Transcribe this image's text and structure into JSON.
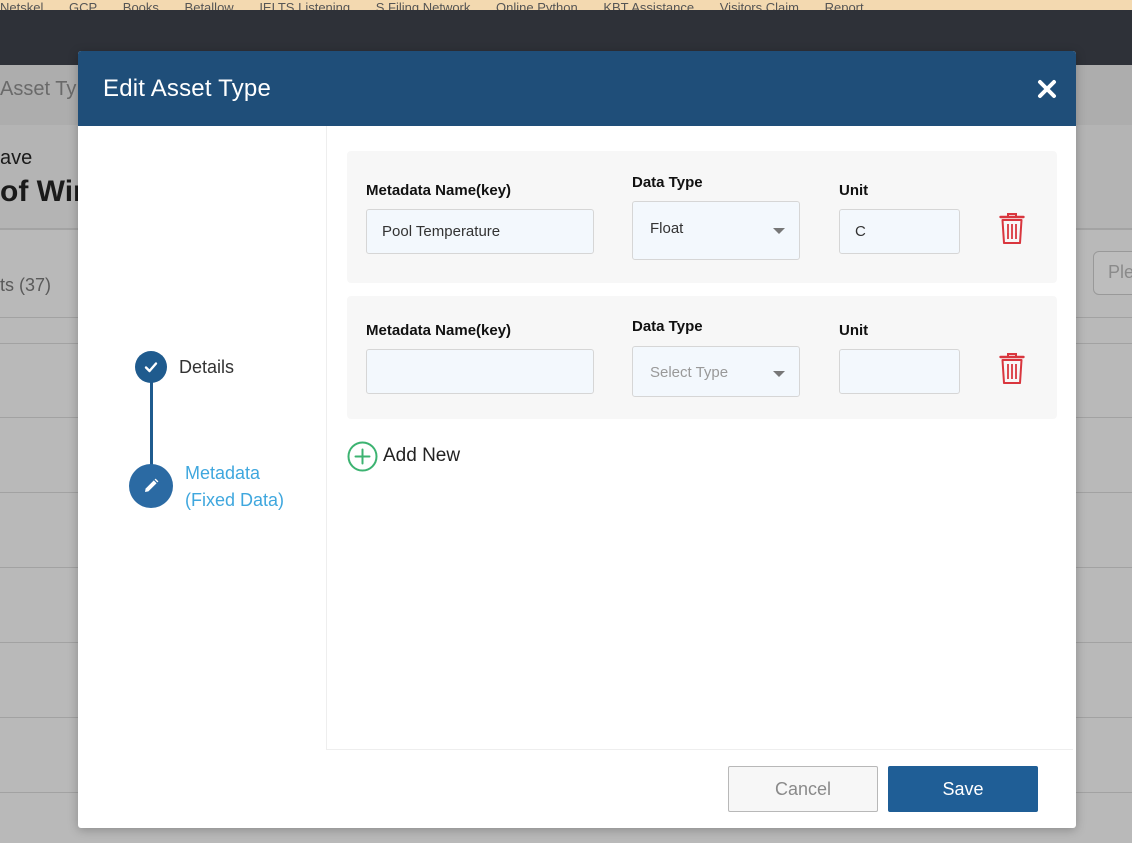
{
  "browser": {
    "bookmarks": [
      "Netskel",
      "GCP",
      "Books",
      "Betallow",
      "IELTS Listening",
      "S Filing Network",
      "Online Python",
      "KBT Assistance",
      "Visitors Claim",
      "Report"
    ]
  },
  "background": {
    "tab_label": "Asset Ty",
    "subtitle": "ave",
    "title": "of Win",
    "count_label": "ts (37)",
    "search_placeholder": "Ple"
  },
  "modal": {
    "title": "Edit Asset Type",
    "close_icon": "close-icon",
    "steps": [
      {
        "label": "Details",
        "status": "completed",
        "icon": "check-icon"
      },
      {
        "label_line1": "Metadata",
        "label_line2": "(Fixed Data)",
        "status": "active",
        "icon": "pencil-icon"
      }
    ],
    "columns": {
      "name": "Metadata Name(key)",
      "type": "Data Type",
      "unit": "Unit"
    },
    "rows": [
      {
        "name": "Pool Temperature",
        "type": "Float",
        "unit": "C"
      },
      {
        "name": "",
        "type": "Select Type",
        "unit": ""
      }
    ],
    "add_new_label": "Add New",
    "cancel_label": "Cancel",
    "save_label": "Save"
  },
  "colors": {
    "header": "#1f4e79",
    "primary": "#1f5e96",
    "active_step_text": "#3fa7de",
    "delete": "#d9363e",
    "add": "#3cb371"
  }
}
